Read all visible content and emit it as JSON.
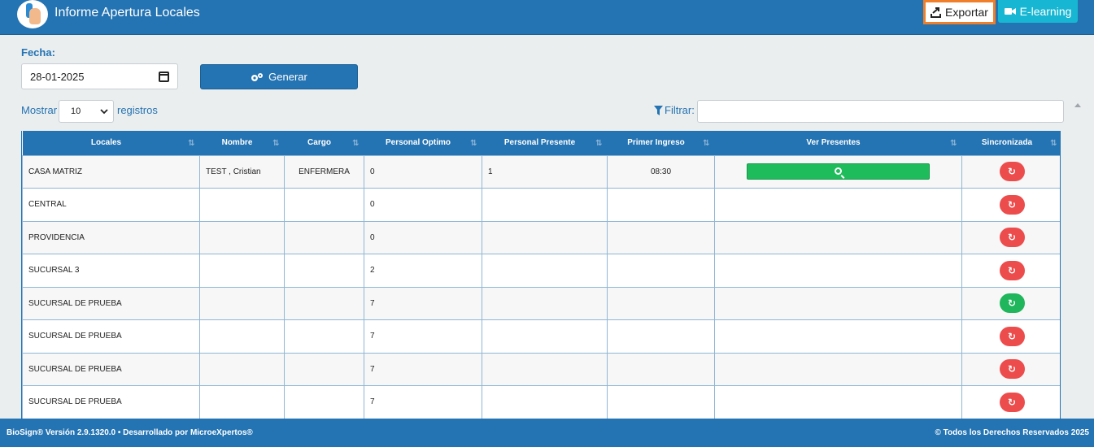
{
  "header": {
    "title": "Informe Apertura Locales",
    "export_label": "Exportar",
    "elearning_label": "E-learning"
  },
  "form": {
    "fecha_label": "Fecha:",
    "fecha_value": "28-01-2025",
    "generar_label": "Generar"
  },
  "table_controls": {
    "mostrar_label": "Mostrar",
    "page_size": "10",
    "registros_label": "registros",
    "filtrar_label": "Filtrar:",
    "filter_value": ""
  },
  "table": {
    "columns": [
      "Locales",
      "Nombre",
      "Cargo",
      "Personal Optimo",
      "Personal Presente",
      "Primer Ingreso",
      "Ver Presentes",
      "Sincronizada"
    ],
    "rows": [
      {
        "locales": "CASA MATRIZ",
        "nombre": "TEST , Cristian",
        "cargo": "ENFERMERA",
        "optimo": "0",
        "presente": "1",
        "ingreso": "08:30",
        "ver": true,
        "sync": "red"
      },
      {
        "locales": "CENTRAL",
        "nombre": "",
        "cargo": "",
        "optimo": "0",
        "presente": "",
        "ingreso": "",
        "ver": false,
        "sync": "red"
      },
      {
        "locales": "PROVIDENCIA",
        "nombre": "",
        "cargo": "",
        "optimo": "0",
        "presente": "",
        "ingreso": "",
        "ver": false,
        "sync": "red"
      },
      {
        "locales": "SUCURSAL 3",
        "nombre": "",
        "cargo": "",
        "optimo": "2",
        "presente": "",
        "ingreso": "",
        "ver": false,
        "sync": "red"
      },
      {
        "locales": "SUCURSAL DE PRUEBA",
        "nombre": "",
        "cargo": "",
        "optimo": "7",
        "presente": "",
        "ingreso": "",
        "ver": false,
        "sync": "green"
      },
      {
        "locales": "SUCURSAL DE PRUEBA",
        "nombre": "",
        "cargo": "",
        "optimo": "7",
        "presente": "",
        "ingreso": "",
        "ver": false,
        "sync": "red"
      },
      {
        "locales": "SUCURSAL DE PRUEBA",
        "nombre": "",
        "cargo": "",
        "optimo": "7",
        "presente": "",
        "ingreso": "",
        "ver": false,
        "sync": "red"
      },
      {
        "locales": "SUCURSAL DE PRUEBA",
        "nombre": "",
        "cargo": "",
        "optimo": "7",
        "presente": "",
        "ingreso": "",
        "ver": false,
        "sync": "red"
      }
    ]
  },
  "footer": {
    "left": "BioSign® Versión 2.9.1320.0 • Desarrollado por MicroeXpertos®",
    "right": "© Todos los Derechos Reservados 2025"
  },
  "colors": {
    "primary": "#2473b2",
    "export_border": "#f07f2b",
    "elearning": "#17b6d2",
    "sync_red": "#ec4c4c",
    "sync_green": "#1fb65c",
    "ver_green": "#1fbc5b"
  },
  "icons": {
    "logo": "biosign-hand-logo",
    "export": "export-icon",
    "elearning": "video-camera-icon",
    "generar": "gears-icon",
    "calendar": "calendar-icon",
    "filter": "filter-icon",
    "ver": "zoom-in-icon",
    "sync": "refresh-icon",
    "sort": "sort-icon"
  }
}
